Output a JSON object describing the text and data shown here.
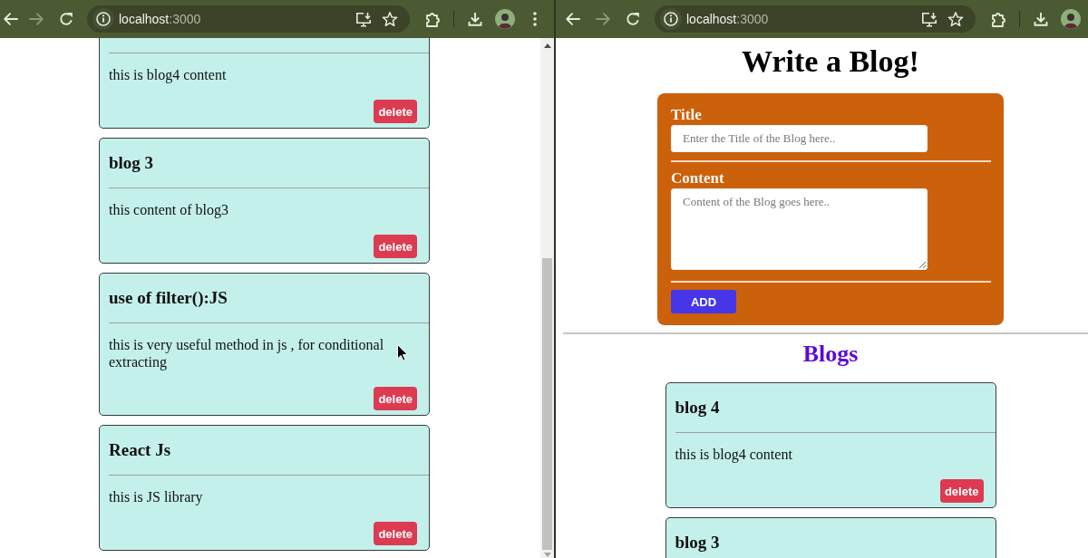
{
  "windows": [
    {
      "navigation": {
        "back_enabled": true,
        "forward_enabled": false
      },
      "address_bar": {
        "host": "localhost",
        "port": ":3000"
      },
      "page": {
        "blogs": [
          {
            "content": "this is blog4 content",
            "delete_label": "delete"
          },
          {
            "title": "blog 3",
            "content": "this content of blog3",
            "delete_label": "delete"
          },
          {
            "title": "use of filter():JS",
            "content": "this is very useful method in js , for conditional extracting",
            "delete_label": "delete"
          },
          {
            "title": "React Js",
            "content": "this is JS library",
            "delete_label": "delete"
          }
        ]
      }
    },
    {
      "navigation": {
        "back_enabled": true,
        "forward_enabled": false
      },
      "address_bar": {
        "host": "localhost",
        "port": ":3000"
      },
      "page": {
        "heading": "Write a Blog!",
        "form": {
          "fields": [
            {
              "kind": "input",
              "label": "Title",
              "placeholder": "Enter the Title of the Blog here.."
            },
            {
              "kind": "textarea",
              "label": "Content",
              "placeholder": "Content of the Blog goes here.."
            }
          ],
          "submit_label": "ADD"
        },
        "blogs_heading": "Blogs",
        "blogs": [
          {
            "title": "blog 4",
            "content": "this is blog4 content",
            "delete_label": "delete"
          },
          {
            "title": "blog 3"
          }
        ]
      }
    }
  ]
}
